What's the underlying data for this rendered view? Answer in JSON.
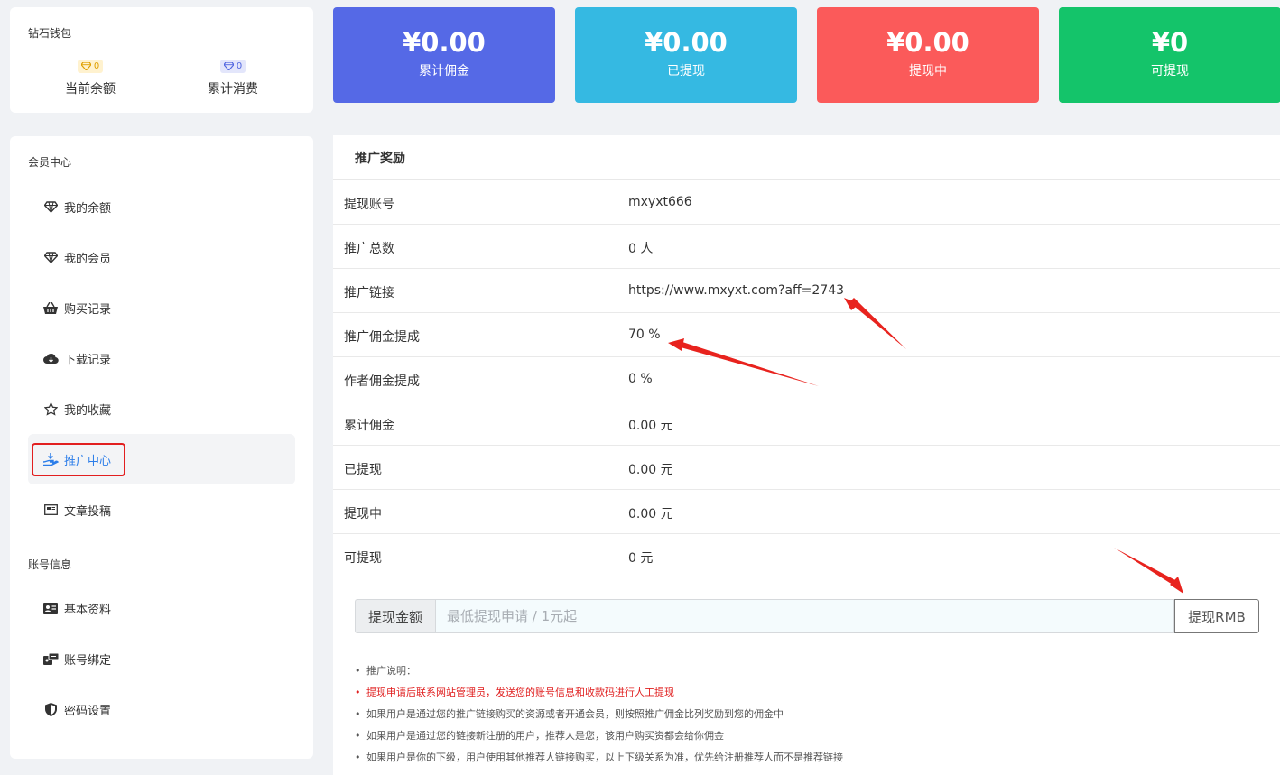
{
  "wallet": {
    "title": "钻石钱包",
    "balance_badge": "0",
    "balance_label": "当前余额",
    "spent_badge": "0",
    "spent_label": "累计消费"
  },
  "stats": [
    {
      "amount": "¥0.00",
      "label": "累计佣金",
      "color": "#5569e6"
    },
    {
      "amount": "¥0.00",
      "label": "已提现",
      "color": "#35b9e2"
    },
    {
      "amount": "¥0.00",
      "label": "提现中",
      "color": "#fb5a5a"
    },
    {
      "amount": "¥0",
      "label": "可提现",
      "color": "#14c46a"
    }
  ],
  "sidebar": {
    "member_title": "会员中心",
    "items": [
      {
        "label": "我的余额",
        "icon": "diamond-icon"
      },
      {
        "label": "我的会员",
        "icon": "diamond-icon"
      },
      {
        "label": "购买记录",
        "icon": "basket-icon"
      },
      {
        "label": "下载记录",
        "icon": "cloud-download-icon"
      },
      {
        "label": "我的收藏",
        "icon": "star-icon"
      },
      {
        "label": "推广中心",
        "icon": "hand-coin-icon",
        "active": true
      },
      {
        "label": "文章投稿",
        "icon": "newspaper-icon"
      }
    ],
    "account_title": "账号信息",
    "account_items": [
      {
        "label": "基本资料",
        "icon": "id-card-icon"
      },
      {
        "label": "账号绑定",
        "icon": "link-icon"
      },
      {
        "label": "密码设置",
        "icon": "shield-icon"
      }
    ]
  },
  "main": {
    "title": "推广奖励",
    "rows": [
      {
        "key": "提现账号",
        "value": "mxyxt666"
      },
      {
        "key": "推广总数",
        "value": "0 人"
      },
      {
        "key": "推广链接",
        "value": "https://www.mxyxt.com?aff=2743"
      },
      {
        "key": "推广佣金提成",
        "value": "70 %"
      },
      {
        "key": "作者佣金提成",
        "value": "0 %"
      },
      {
        "key": "累计佣金",
        "value": "0.00 元"
      },
      {
        "key": "已提现",
        "value": "0.00 元"
      },
      {
        "key": "提现中",
        "value": "0.00 元"
      },
      {
        "key": "可提现",
        "value": "0 元"
      }
    ],
    "withdraw": {
      "label": "提现金额",
      "placeholder": "最低提现申请 / 1元起",
      "button": "提现RMB"
    },
    "notes": [
      {
        "text": "推广说明：",
        "red": false
      },
      {
        "text": "提现申请后联系网站管理员，发送您的账号信息和收款码进行人工提现",
        "red": true
      },
      {
        "text": "如果用户是通过您的推广链接购买的资源或者开通会员，则按照推广佣金比列奖励到您的佣金中",
        "red": false
      },
      {
        "text": "如果用户是通过您的链接新注册的用户，推荐人是您，该用户购买资都会给你佣金",
        "red": false
      },
      {
        "text": "如果用户是你的下级，用户使用其他推荐人链接购买，以上下级关系为准，优先给注册推荐人而不是推荐链接",
        "red": false
      }
    ]
  }
}
